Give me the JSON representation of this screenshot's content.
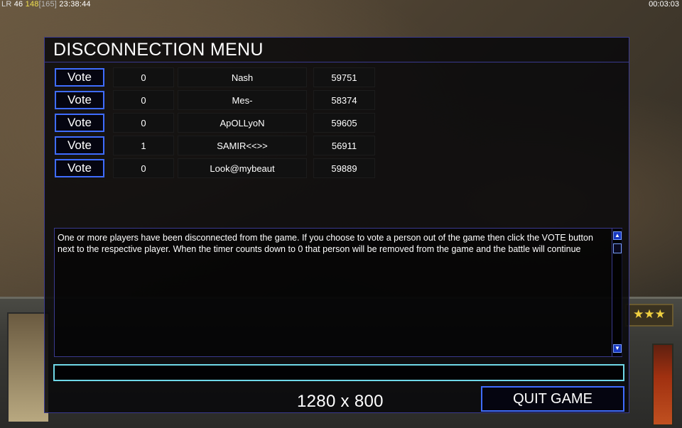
{
  "hud": {
    "left_lr": "LR",
    "left_a": "46",
    "left_b": "148",
    "left_c": "[165]",
    "left_time": "23:38:44",
    "right_time": "00:03:03",
    "stars": "★★★"
  },
  "dialog": {
    "title": "DISCONNECTION MENU",
    "vote_label": "Vote",
    "players": [
      {
        "votes": "0",
        "name": "Nash",
        "id": "59751"
      },
      {
        "votes": "0",
        "name": "Mes-",
        "id": "58374"
      },
      {
        "votes": "0",
        "name": "ApOLLyoN",
        "id": "59605"
      },
      {
        "votes": "1",
        "name": "SAMIR<<>>",
        "id": "56911"
      },
      {
        "votes": "0",
        "name": "Look@mybeaut",
        "id": "59889"
      }
    ],
    "message": "One or more players have been disconnected from the game. If you choose to vote a person out of the game then click the VOTE button next to the respective player. When the timer counts down to 0 that person will be removed from the game and the battle will continue",
    "chat_value": "",
    "resolution": "1280 x 800",
    "quit_label": "QUIT GAME"
  }
}
